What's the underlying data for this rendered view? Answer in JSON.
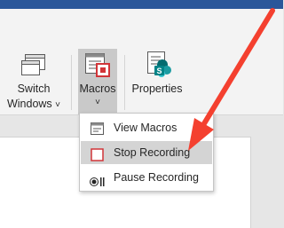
{
  "ribbon": {
    "switch_windows": {
      "line1": "Switch",
      "line2": "Windows",
      "chevron": "˅"
    },
    "macros": {
      "label": "Macros",
      "chevron": "˅"
    },
    "properties": {
      "label": "Properties"
    }
  },
  "macros_menu": {
    "items": [
      {
        "label": "View Macros",
        "icon": "view-macros-icon"
      },
      {
        "label": "Stop Recording",
        "icon": "stop-recording-icon",
        "highlighted": true
      },
      {
        "label": "Pause Recording",
        "icon": "pause-recording-icon"
      }
    ]
  },
  "colors": {
    "title_bar": "#2b579a",
    "ribbon_bg": "#f3f3f3",
    "menu_hover": "#d4d4d4",
    "stop_icon": "#d13438",
    "sharepoint": "#038387",
    "annotation_arrow": "#f4402f"
  }
}
